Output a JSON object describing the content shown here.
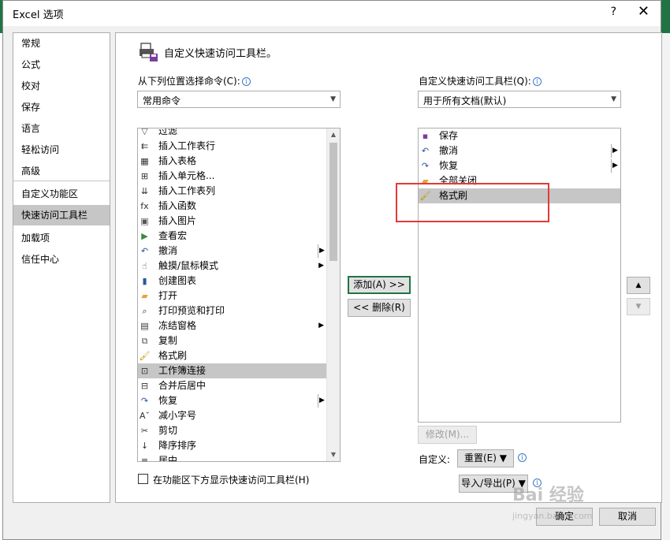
{
  "dialog": {
    "title": "Excel 选项",
    "help": "?",
    "close": "✕"
  },
  "nav": {
    "items": [
      {
        "label": "常规"
      },
      {
        "label": "公式"
      },
      {
        "label": "校对"
      },
      {
        "label": "保存"
      },
      {
        "label": "语言"
      },
      {
        "label": "轻松访问"
      },
      {
        "label": "高级"
      },
      {
        "label": "自定义功能区"
      },
      {
        "label": "快速访问工具栏",
        "selected": true
      },
      {
        "label": "加载项"
      },
      {
        "label": "信任中心"
      }
    ]
  },
  "header": {
    "title": "自定义快速访问工具栏。"
  },
  "left": {
    "choose_label": "从下列位置选择命令(C):",
    "choose_value": "常用命令",
    "commands": [
      {
        "label": "过滤",
        "icon": "filter-icon",
        "glyph": "▽",
        "color": "#555"
      },
      {
        "label": "插入工作表行",
        "icon": "insert-row-icon",
        "glyph": "⇇",
        "color": "#333"
      },
      {
        "label": "插入表格",
        "icon": "table-icon",
        "glyph": "▦",
        "color": "#333"
      },
      {
        "label": "插入单元格...",
        "icon": "insert-cells-icon",
        "glyph": "⊞",
        "color": "#333"
      },
      {
        "label": "插入工作表列",
        "icon": "insert-column-icon",
        "glyph": "⇊",
        "color": "#333"
      },
      {
        "label": "插入函数",
        "icon": "function-icon",
        "glyph": "fx",
        "color": "#333"
      },
      {
        "label": "插入图片",
        "icon": "picture-icon",
        "glyph": "▣",
        "color": "#555"
      },
      {
        "label": "查看宏",
        "icon": "play-macro-icon",
        "glyph": "▶",
        "color": "#3a8a3a"
      },
      {
        "label": "撤消",
        "icon": "undo-icon",
        "glyph": "↶",
        "color": "#2b579a",
        "submenu": "box"
      },
      {
        "label": "触摸/鼠标模式",
        "icon": "touch-mode-icon",
        "glyph": "☝",
        "color": "#555",
        "submenu": "arrow"
      },
      {
        "label": "创建图表",
        "icon": "chart-icon",
        "glyph": "▮",
        "color": "#2b579a"
      },
      {
        "label": "打开",
        "icon": "open-folder-icon",
        "glyph": "▰",
        "color": "#e8a33a"
      },
      {
        "label": "打印预览和打印",
        "icon": "print-preview-icon",
        "glyph": "⌕",
        "color": "#333"
      },
      {
        "label": "冻结窗格",
        "icon": "freeze-panes-icon",
        "glyph": "▤",
        "color": "#333",
        "submenu": "arrow"
      },
      {
        "label": "复制",
        "icon": "copy-icon",
        "glyph": "⧉",
        "color": "#555"
      },
      {
        "label": "格式刷",
        "icon": "format-painter-icon",
        "glyph": "🖌",
        "color": "#c29600"
      },
      {
        "label": "工作簿连接",
        "icon": "workbook-connection-icon",
        "glyph": "⊡",
        "color": "#333",
        "selected": true
      },
      {
        "label": "合并后居中",
        "icon": "merge-center-icon",
        "glyph": "⊟",
        "color": "#333"
      },
      {
        "label": "恢复",
        "icon": "redo-icon",
        "glyph": "↷",
        "color": "#2b579a",
        "submenu": "box"
      },
      {
        "label": "减小字号",
        "icon": "decrease-font-icon",
        "glyph": "Aˇ",
        "color": "#333"
      },
      {
        "label": "剪切",
        "icon": "cut-icon",
        "glyph": "✂",
        "color": "#333"
      },
      {
        "label": "降序排序",
        "icon": "sort-desc-icon",
        "glyph": "↓",
        "color": "#333"
      },
      {
        "label": "居中",
        "icon": "center-align-icon",
        "glyph": "≡",
        "color": "#333"
      }
    ],
    "checkbox_label": "在功能区下方显示快速访问工具栏(H)"
  },
  "middle": {
    "add_label": "添加(A) >>",
    "remove_label": "<< 删除(R)"
  },
  "right": {
    "customize_label": "自定义快速访问工具栏(Q):",
    "customize_value": "用于所有文档(默认)",
    "items": [
      {
        "label": "保存",
        "icon": "save-icon",
        "glyph": "▪",
        "color": "#7a3f9d"
      },
      {
        "label": "撤消",
        "icon": "undo-icon",
        "glyph": "↶",
        "color": "#2b579a",
        "submenu": "box"
      },
      {
        "label": "恢复",
        "icon": "redo-icon",
        "glyph": "↷",
        "color": "#2b579a",
        "submenu": "box"
      },
      {
        "label": "全部关闭",
        "icon": "close-all-icon",
        "glyph": "▰",
        "color": "#e8a33a"
      },
      {
        "label": "格式刷",
        "icon": "format-painter-icon",
        "glyph": "🖌",
        "color": "#c29600",
        "selected": true
      }
    ],
    "modify_label": "修改(M)...",
    "custom_label": "自定义:",
    "reset_label": "重置(E) ▼",
    "import_export_label": "导入/导出(P) ▼",
    "move_up": "▲",
    "move_down": "▼"
  },
  "footer": {
    "ok_label": "确定",
    "cancel_label": "取消"
  },
  "watermark": {
    "text": "Bai 经验",
    "url": "jingyan.baidu.com"
  }
}
